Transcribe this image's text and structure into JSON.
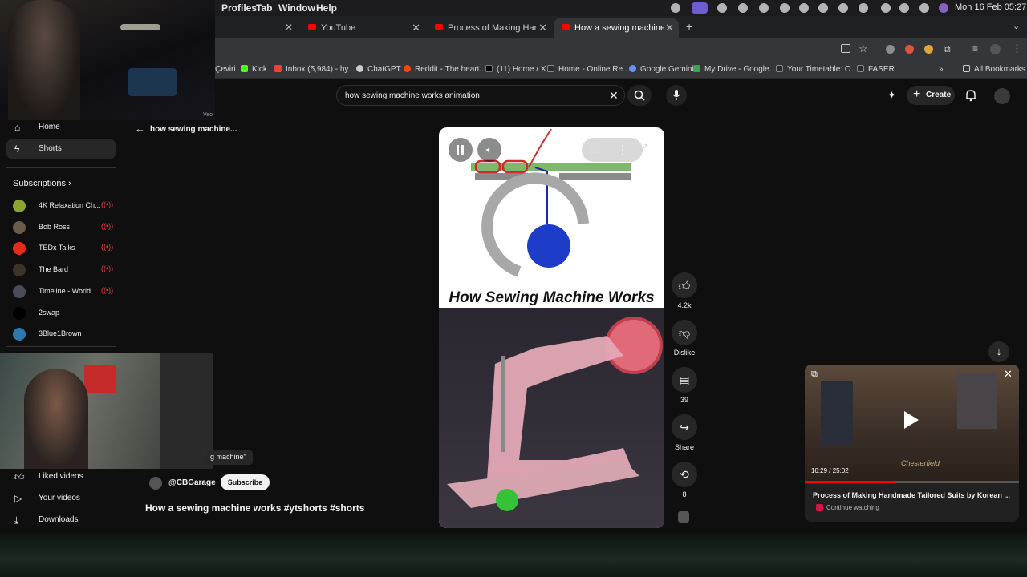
{
  "menubar": {
    "items": [
      "Profiles",
      "Tab",
      "Window",
      "Help"
    ],
    "datetime": "Mon 16 Feb  05:27"
  },
  "tabs": [
    {
      "title": "YouTube"
    },
    {
      "title": "Process of Making Handmade"
    },
    {
      "title": "How a sewing machine works"
    }
  ],
  "bookmarks": {
    "items": [
      "Çeviri",
      "Kick",
      "Inbox (5,984) - hy...",
      "ChatGPT",
      "Reddit - The heart...",
      "(11) Home / X",
      "Home - Online Re...",
      "Google Gemini",
      "My Drive - Google...",
      "Your Timetable: O...",
      "FASER"
    ],
    "all": "All Bookmarks"
  },
  "search": {
    "value": "how sewing machine works animation"
  },
  "header": {
    "create": "Create"
  },
  "sidebar": {
    "home": "Home",
    "shorts": "Shorts",
    "subscriptions_title": "Subscriptions",
    "subscriptions": [
      {
        "name": "4K Relaxation Ch...",
        "color": "#8aa52e"
      },
      {
        "name": "Bob Ross",
        "color": "#6b5b4d"
      },
      {
        "name": "TEDx Talks",
        "color": "#e62b1e"
      },
      {
        "name": "The Bard",
        "color": "#3d3429"
      },
      {
        "name": "Timeline - World ...",
        "color": "#4a4d59"
      },
      {
        "name": "2swap",
        "color": "#000000"
      },
      {
        "name": "3Blue1Brown",
        "color": "#2c79b0"
      }
    ],
    "liked": "Liked videos",
    "your_videos": "Your videos",
    "downloads": "Downloads"
  },
  "back_query": "how sewing machine...",
  "caption_tail": "g machine\"",
  "video": {
    "overlay_title": "How Sewing Machine Works",
    "channel": "@CBGarage",
    "subscribe": "Subscribe",
    "title": "How a sewing machine works #ytshorts #shorts"
  },
  "actions": {
    "likes": "4.2k",
    "dislike": "Dislike",
    "comments": "39",
    "share": "Share",
    "remix": "8"
  },
  "miniplayer": {
    "time": "10:29 / 25:02",
    "progress": 0.42,
    "title": "Process of Making Handmade Tailored Suits by Korean ...",
    "sub": "Continue watching",
    "sign": "Chesterfield"
  },
  "webcam_label": "Veo"
}
